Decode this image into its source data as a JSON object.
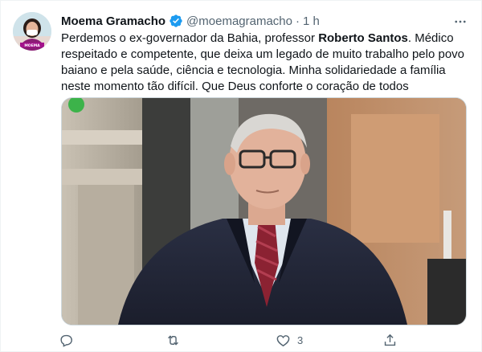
{
  "tweet": {
    "author_name": "Moema Gramacho",
    "handle": "@moemagramacho",
    "separator": "·",
    "time": "1 h",
    "text_before": "Perdemos o ex-governador da Bahia, professor ",
    "text_bold": "Roberto Santos",
    "text_after": ". Médico respeitado e competente, que deixa um legado de muito trabalho pelo povo baiano e pela saúde, ciência e tecnologia. Minha solidariedade a família neste momento tão difícil. Que Deus conforte o coração de todos",
    "avatar_badge": "MOEMA"
  },
  "actions": {
    "reply_count": "",
    "retweet_count": "",
    "like_count": "3",
    "share_count": ""
  },
  "icons": {
    "verified": "verified-badge-icon",
    "more": "more-options-icon",
    "reply": "reply-icon",
    "retweet": "retweet-icon",
    "like": "heart-icon",
    "share": "share-icon"
  },
  "colors": {
    "text_primary": "#0f1419",
    "text_secondary": "#536471",
    "verified_blue": "#1d9bf0",
    "avatar_badge": "#a3128c"
  }
}
